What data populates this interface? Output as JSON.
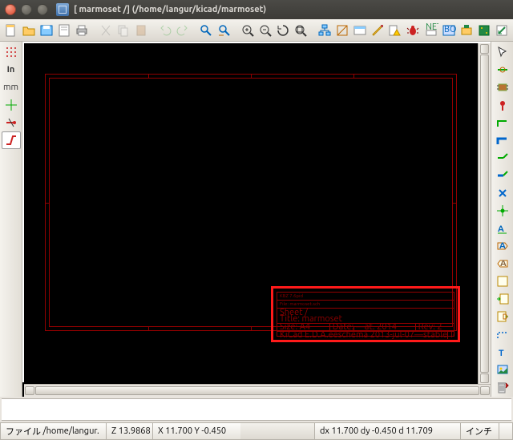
{
  "window": {
    "title": "[ marmoset /] (/home/langur/kicad/marmoset)"
  },
  "left_toolbar": {
    "in_label": "In",
    "mm_label": "mm"
  },
  "titleblock": {
    "row1": "KBZ 7.6pid",
    "row2": "File: marmoset.sch",
    "row3": "Sheet /",
    "row4": "Title: marmoset",
    "row5a": "Size: A4",
    "row5b": "Date: —at. 2014",
    "row5c": "Rev: 2",
    "row6a": "KiCad E.D.A.",
    "row6b": "eeschema  2013-jul-07—stable",
    "row6c": "Id: 1/1"
  },
  "status": {
    "file_label": "ファイル",
    "file_path": "/home/langur.",
    "z": "Z 13.9868",
    "xy": "X 11.700  Y -0.450",
    "dxy": "dx 11.700  dy -0.450  d 11.709",
    "unit": "インチ"
  }
}
